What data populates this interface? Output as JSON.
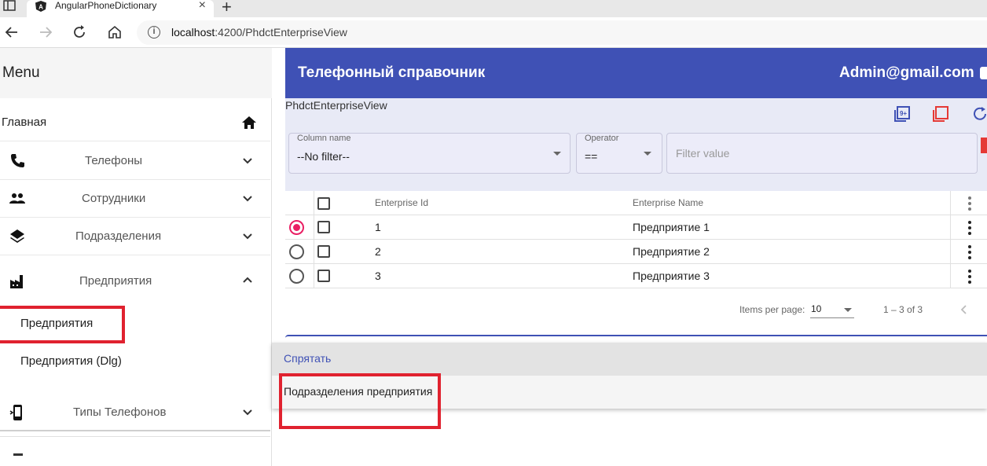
{
  "browser": {
    "tab_title": "AngularPhoneDictionary",
    "url_host": "localhost",
    "url_path": ":4200/PhdctEnterpriseView"
  },
  "sidebar": {
    "title": "Menu",
    "home_label": "Главная",
    "items": [
      {
        "label": "Телефоны",
        "icon": "phone-icon"
      },
      {
        "label": "Сотрудники",
        "icon": "people-icon"
      },
      {
        "label": "Подразделения",
        "icon": "layers-icon"
      },
      {
        "label": "Предприятия",
        "icon": "factory-icon",
        "expanded": true
      },
      {
        "label": "Типы Телефонов",
        "icon": "phone-device-icon"
      }
    ],
    "sub_items": [
      "Предприятия",
      "Предприятия (Dlg)"
    ]
  },
  "toolbar": {
    "title": "Телефонный справочник",
    "user": "Admin@gmail.com"
  },
  "view": {
    "title": "PhdctEnterpriseView",
    "filter": {
      "column_label": "Column name",
      "column_value": "--No filter--",
      "operator_label": "Operator",
      "operator_value": "==",
      "value_placeholder": "Filter value"
    }
  },
  "table": {
    "columns": [
      "Enterprise Id",
      "Enterprise Name"
    ],
    "rows": [
      {
        "id": "1",
        "name": "Предприятие 1",
        "selected": true
      },
      {
        "id": "2",
        "name": "Предприятие 2",
        "selected": false
      },
      {
        "id": "3",
        "name": "Предприятие 3",
        "selected": false
      }
    ]
  },
  "paginator": {
    "items_per_page_label": "Items per page:",
    "page_size": "10",
    "range": "1 – 3 of 3"
  },
  "context_menu": {
    "hide_label": "Спрятать",
    "sub_label": "Подразделения предприятия"
  },
  "colors": {
    "primary": "#3f51b5",
    "accent": "#e91e63",
    "highlight": "#e0222f"
  }
}
